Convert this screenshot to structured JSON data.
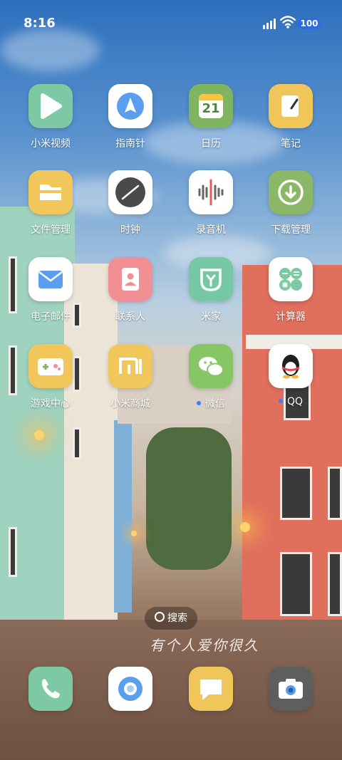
{
  "status": {
    "time": "8:16",
    "battery": "100"
  },
  "apps": [
    {
      "label": "小米视频",
      "icon": "play-icon"
    },
    {
      "label": "指南针",
      "icon": "compass-icon"
    },
    {
      "label": "日历",
      "icon": "calendar-icon",
      "date": "21"
    },
    {
      "label": "笔记",
      "icon": "notes-icon"
    },
    {
      "label": "文件管理",
      "icon": "folder-icon"
    },
    {
      "label": "时钟",
      "icon": "clock-icon"
    },
    {
      "label": "录音机",
      "icon": "waveform-icon"
    },
    {
      "label": "下载管理",
      "icon": "download-icon"
    },
    {
      "label": "电子邮件",
      "icon": "mail-icon"
    },
    {
      "label": "联系人",
      "icon": "contacts-icon"
    },
    {
      "label": "米家",
      "icon": "mijia-icon"
    },
    {
      "label": "计算器",
      "icon": "calculator-icon"
    },
    {
      "label": "游戏中心",
      "icon": "gamepad-icon"
    },
    {
      "label": "小米商城",
      "icon": "mi-store-icon"
    },
    {
      "label": "微信",
      "icon": "wechat-icon"
    },
    {
      "label": "QQ",
      "icon": "qq-icon"
    }
  ],
  "dock": [
    {
      "icon": "phone-icon"
    },
    {
      "icon": "browser-icon"
    },
    {
      "icon": "messages-icon"
    },
    {
      "icon": "camera-icon"
    }
  ],
  "search_label": "搜索",
  "wallpaper_text": "有个人爱你很久",
  "colors": {
    "video": "#7cc9a3",
    "compass": "#ffffff",
    "calendar": "#7fb461",
    "notes": "#f0c65a",
    "files": "#f1c65b",
    "clock": "#ffffff",
    "recorder": "#ffffff",
    "download": "#8bb866",
    "mail": "#ffffff",
    "contacts": "#f28f95",
    "mijia": "#76c7a3",
    "calculator": "#ffffff",
    "game": "#f1c65b",
    "store": "#f1c65b",
    "wechat": "#86c665",
    "qq": "#ffffff",
    "phone": "#7cc9a3",
    "browser": "#ffffff",
    "messages": "#f0c65a",
    "camera": "#5e5e5e"
  }
}
